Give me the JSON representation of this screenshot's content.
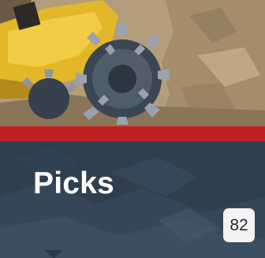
{
  "card": {
    "title": "Picks",
    "count": "82",
    "image_subject": "machine-photo",
    "colors": {
      "accent": "#c01f24",
      "panel": "#2f3f50",
      "title": "#ffffff",
      "badge_bg": "#f3f3f3",
      "badge_text": "#2a2a2a"
    }
  }
}
